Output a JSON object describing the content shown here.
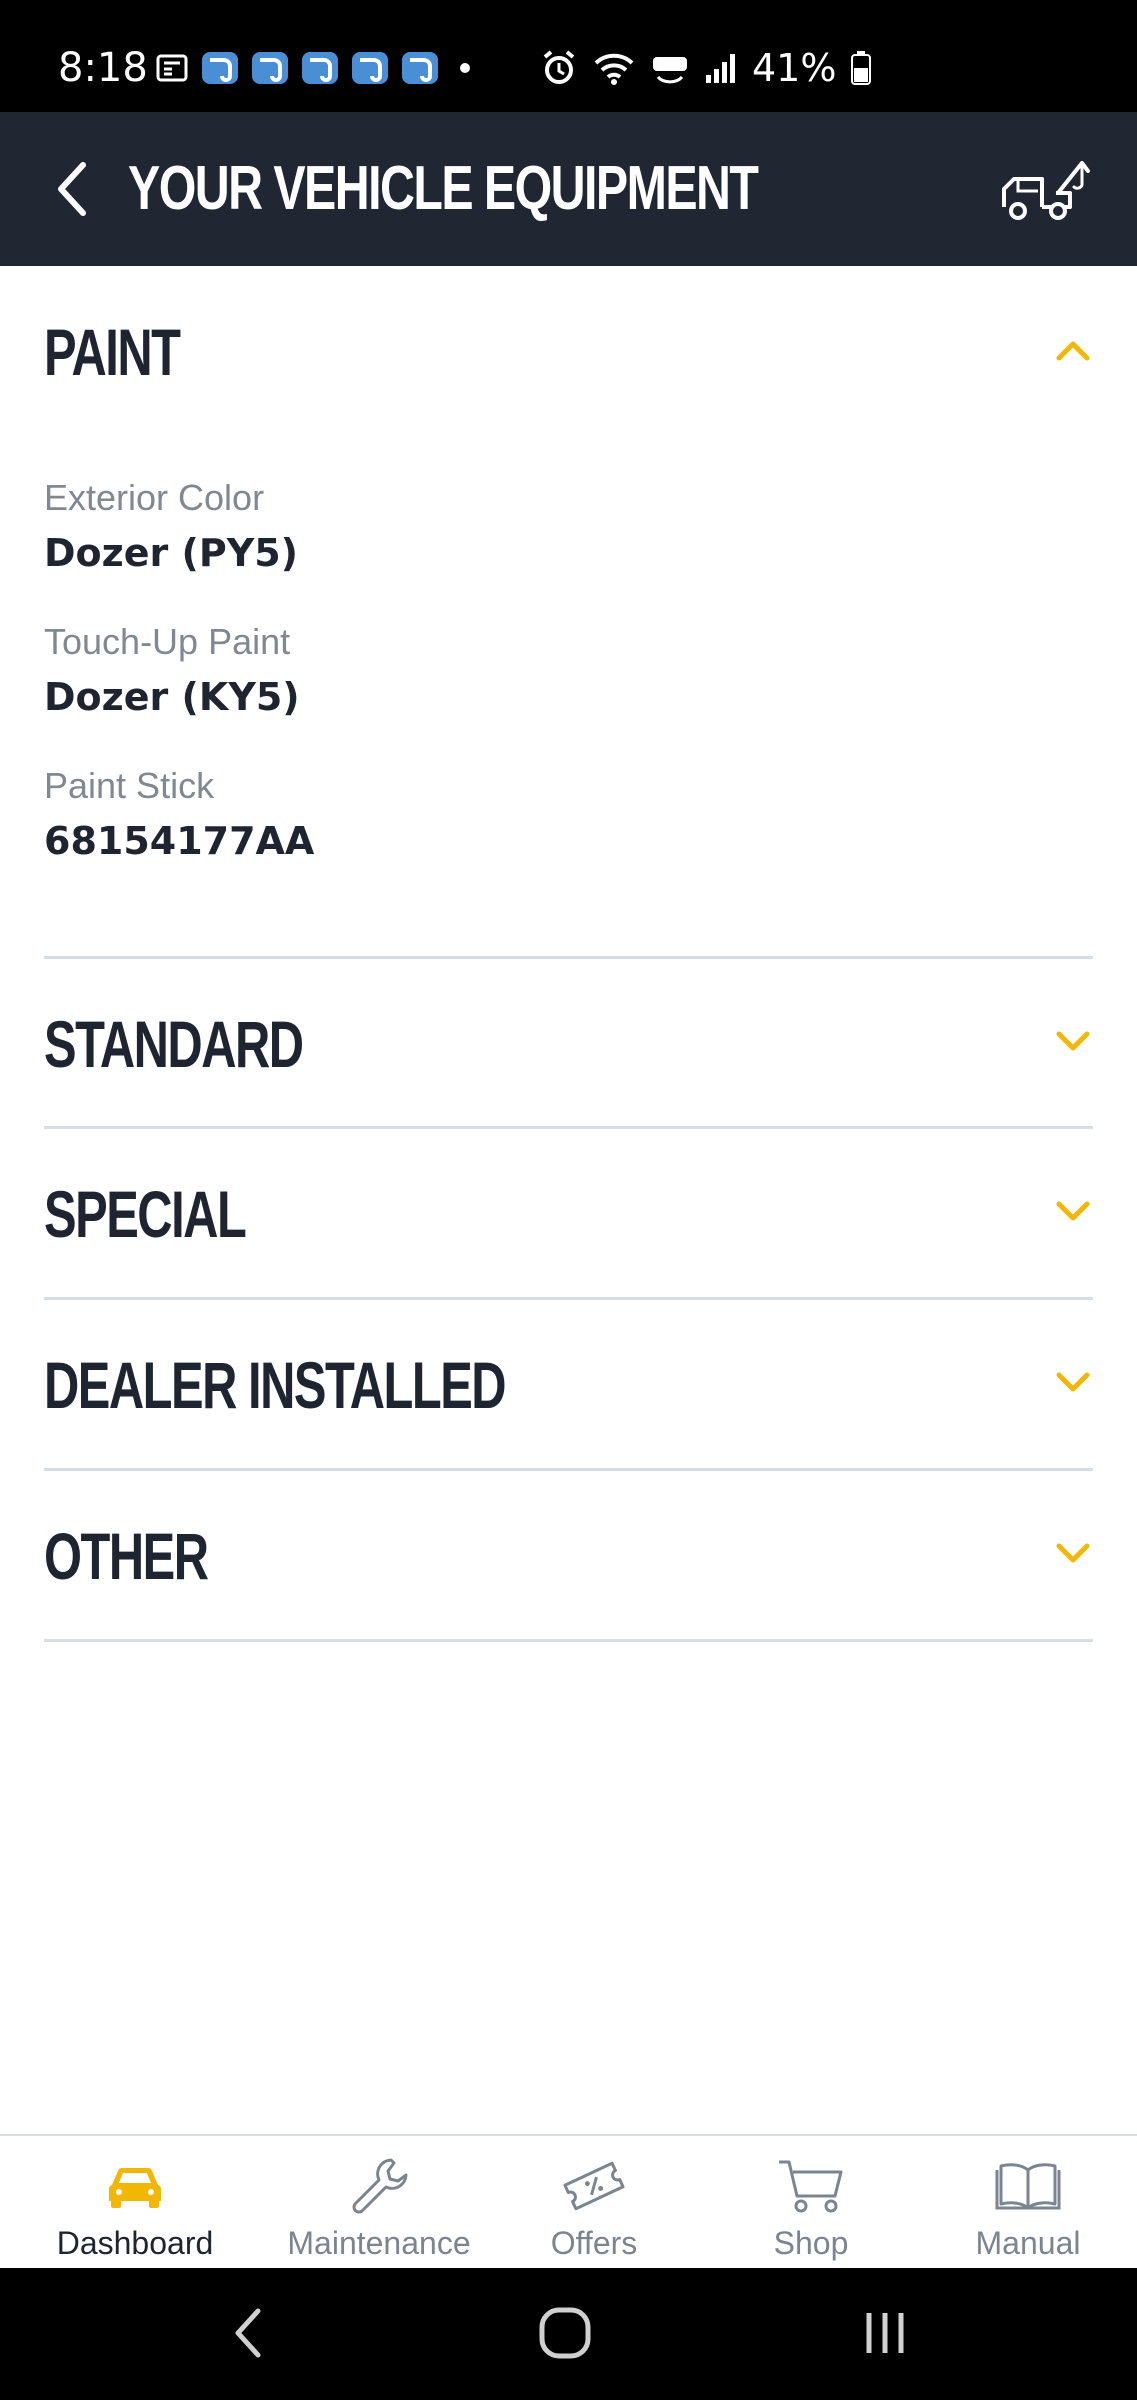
{
  "status_bar": {
    "time": "8:18",
    "battery": "41%"
  },
  "header": {
    "title": "YOUR VEHICLE EQUIPMENT"
  },
  "paint": {
    "title": "PAINT",
    "fields": [
      {
        "label": "Exterior Color",
        "value": "Dozer (PY5)"
      },
      {
        "label": "Touch-Up Paint",
        "value": "Dozer (KY5)"
      },
      {
        "label": "Paint Stick",
        "value": "68154177AA"
      }
    ]
  },
  "sections": [
    {
      "title": "STANDARD"
    },
    {
      "title": "SPECIAL"
    },
    {
      "title": "DEALER INSTALLED"
    },
    {
      "title": "OTHER"
    }
  ],
  "bottom_nav": [
    {
      "label": "Dashboard",
      "icon": "car-icon",
      "active": true
    },
    {
      "label": "Maintenance",
      "icon": "wrench-icon"
    },
    {
      "label": "Offers",
      "icon": "coupon-icon"
    },
    {
      "label": "Shop",
      "icon": "cart-icon"
    },
    {
      "label": "Manual",
      "icon": "book-icon"
    }
  ],
  "colors": {
    "header_bg": "#202733",
    "accent": "#f2b705",
    "text_dark": "#1f2530",
    "label_gray": "#808892",
    "divider": "#d6dde4"
  }
}
